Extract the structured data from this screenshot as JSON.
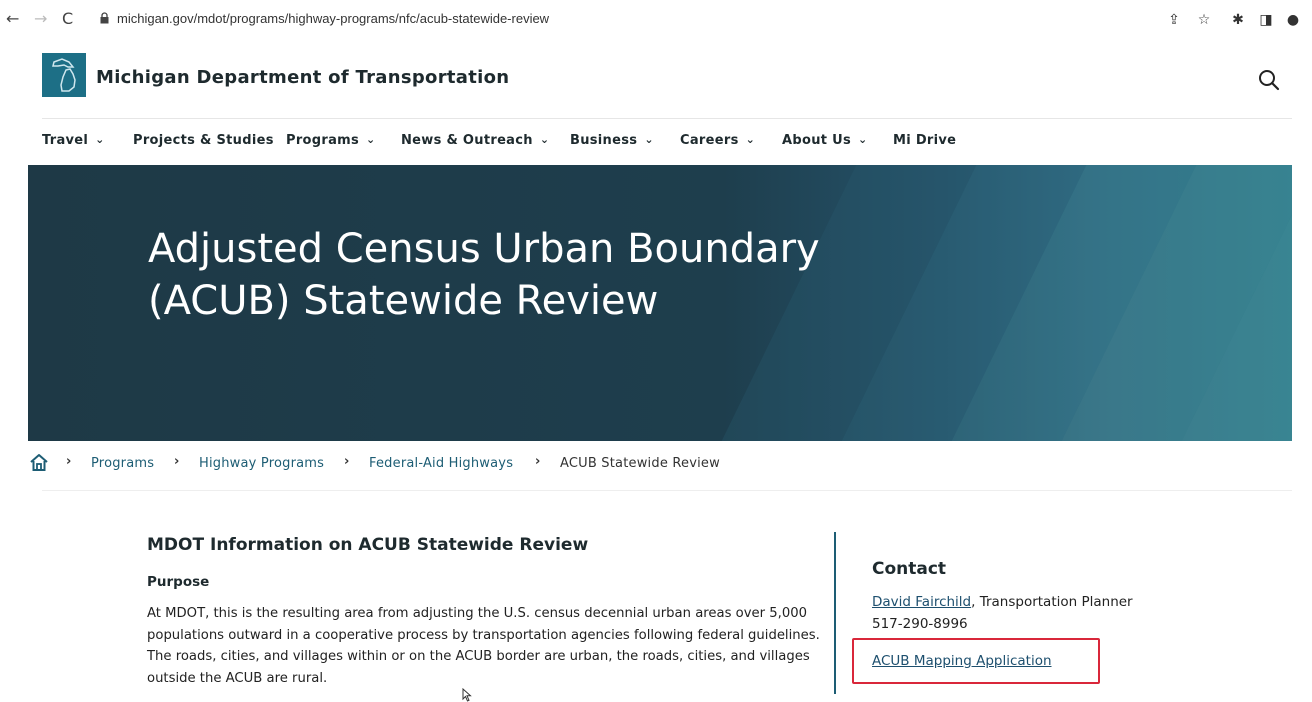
{
  "browser": {
    "url": "michigan.gov/mdot/programs/highway-programs/nfc/acub-statewide-review"
  },
  "header": {
    "site_title": "Michigan Department of Transportation"
  },
  "nav": {
    "items": [
      {
        "label": "Travel",
        "has_menu": true
      },
      {
        "label": "Projects & Studies",
        "has_menu": false
      },
      {
        "label": "Programs",
        "has_menu": true
      },
      {
        "label": "News & Outreach",
        "has_menu": true
      },
      {
        "label": "Business",
        "has_menu": true
      },
      {
        "label": "Careers",
        "has_menu": true
      },
      {
        "label": "About Us",
        "has_menu": true
      },
      {
        "label": "Mi Drive",
        "has_menu": false
      }
    ]
  },
  "hero": {
    "title": "Adjusted Census Urban Boundary (ACUB) Statewide Review"
  },
  "breadcrumb": {
    "items": [
      "Programs",
      "Highway Programs",
      "Federal-Aid Highways",
      "ACUB Statewide Review"
    ]
  },
  "main": {
    "heading": "MDOT Information on ACUB Statewide Review",
    "subheading": "Purpose",
    "paragraph": "At MDOT, this is the resulting area from adjusting the U.S. census decennial urban areas over 5,000 populations outward in a cooperative process by transportation agencies following federal guidelines. The roads, cities, and villages within or on the ACUB border are urban, the roads, cities, and villages outside the ACUB are rural."
  },
  "contact": {
    "heading": "Contact",
    "name": "David Fairchild",
    "role": ", Transportation Planner",
    "phone": "517-290-8996",
    "app_link": "ACUB Mapping Application"
  },
  "colors": {
    "brand_teal": "#1d6f86",
    "link": "#1d4f6e",
    "highlight_box": "#d9273a",
    "hero_dark": "#1e3946"
  }
}
